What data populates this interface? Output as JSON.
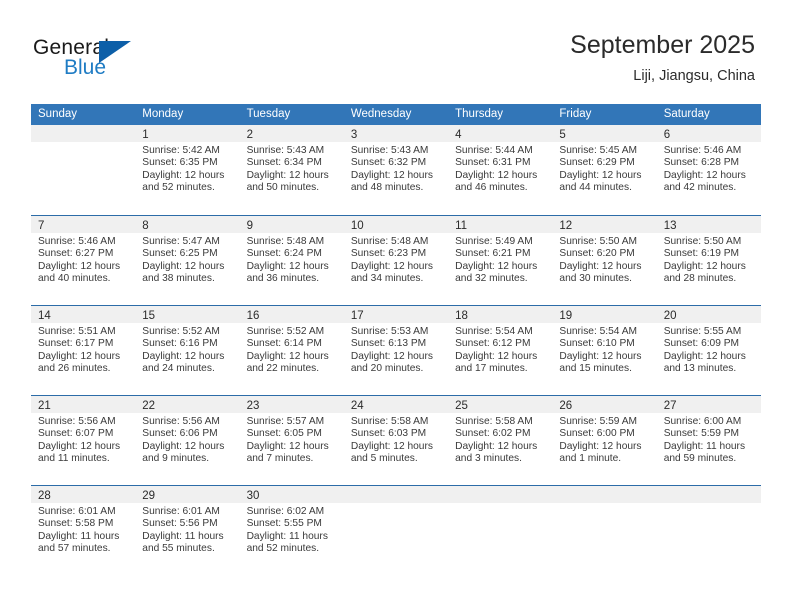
{
  "brand": {
    "name_part1": "General",
    "name_part2": "Blue",
    "accent_color": "#0d5fa8",
    "blue_text_color": "#1f7cc4"
  },
  "header": {
    "title": "September 2025",
    "subtitle": "Liji, Jiangsu, China"
  },
  "calendar": {
    "header_bg": "#3276b8",
    "row_divider": "#2c6ca8",
    "day_band_bg": "#f0f0f0",
    "weekdays": [
      "Sunday",
      "Monday",
      "Tuesday",
      "Wednesday",
      "Thursday",
      "Friday",
      "Saturday"
    ],
    "weeks": [
      [
        {
          "day": "",
          "empty": true
        },
        {
          "day": "1",
          "sunrise": "Sunrise: 5:42 AM",
          "sunset": "Sunset: 6:35 PM",
          "daylight_1": "Daylight: 12 hours",
          "daylight_2": "and 52 minutes."
        },
        {
          "day": "2",
          "sunrise": "Sunrise: 5:43 AM",
          "sunset": "Sunset: 6:34 PM",
          "daylight_1": "Daylight: 12 hours",
          "daylight_2": "and 50 minutes."
        },
        {
          "day": "3",
          "sunrise": "Sunrise: 5:43 AM",
          "sunset": "Sunset: 6:32 PM",
          "daylight_1": "Daylight: 12 hours",
          "daylight_2": "and 48 minutes."
        },
        {
          "day": "4",
          "sunrise": "Sunrise: 5:44 AM",
          "sunset": "Sunset: 6:31 PM",
          "daylight_1": "Daylight: 12 hours",
          "daylight_2": "and 46 minutes."
        },
        {
          "day": "5",
          "sunrise": "Sunrise: 5:45 AM",
          "sunset": "Sunset: 6:29 PM",
          "daylight_1": "Daylight: 12 hours",
          "daylight_2": "and 44 minutes."
        },
        {
          "day": "6",
          "sunrise": "Sunrise: 5:46 AM",
          "sunset": "Sunset: 6:28 PM",
          "daylight_1": "Daylight: 12 hours",
          "daylight_2": "and 42 minutes."
        }
      ],
      [
        {
          "day": "7",
          "sunrise": "Sunrise: 5:46 AM",
          "sunset": "Sunset: 6:27 PM",
          "daylight_1": "Daylight: 12 hours",
          "daylight_2": "and 40 minutes."
        },
        {
          "day": "8",
          "sunrise": "Sunrise: 5:47 AM",
          "sunset": "Sunset: 6:25 PM",
          "daylight_1": "Daylight: 12 hours",
          "daylight_2": "and 38 minutes."
        },
        {
          "day": "9",
          "sunrise": "Sunrise: 5:48 AM",
          "sunset": "Sunset: 6:24 PM",
          "daylight_1": "Daylight: 12 hours",
          "daylight_2": "and 36 minutes."
        },
        {
          "day": "10",
          "sunrise": "Sunrise: 5:48 AM",
          "sunset": "Sunset: 6:23 PM",
          "daylight_1": "Daylight: 12 hours",
          "daylight_2": "and 34 minutes."
        },
        {
          "day": "11",
          "sunrise": "Sunrise: 5:49 AM",
          "sunset": "Sunset: 6:21 PM",
          "daylight_1": "Daylight: 12 hours",
          "daylight_2": "and 32 minutes."
        },
        {
          "day": "12",
          "sunrise": "Sunrise: 5:50 AM",
          "sunset": "Sunset: 6:20 PM",
          "daylight_1": "Daylight: 12 hours",
          "daylight_2": "and 30 minutes."
        },
        {
          "day": "13",
          "sunrise": "Sunrise: 5:50 AM",
          "sunset": "Sunset: 6:19 PM",
          "daylight_1": "Daylight: 12 hours",
          "daylight_2": "and 28 minutes."
        }
      ],
      [
        {
          "day": "14",
          "sunrise": "Sunrise: 5:51 AM",
          "sunset": "Sunset: 6:17 PM",
          "daylight_1": "Daylight: 12 hours",
          "daylight_2": "and 26 minutes."
        },
        {
          "day": "15",
          "sunrise": "Sunrise: 5:52 AM",
          "sunset": "Sunset: 6:16 PM",
          "daylight_1": "Daylight: 12 hours",
          "daylight_2": "and 24 minutes."
        },
        {
          "day": "16",
          "sunrise": "Sunrise: 5:52 AM",
          "sunset": "Sunset: 6:14 PM",
          "daylight_1": "Daylight: 12 hours",
          "daylight_2": "and 22 minutes."
        },
        {
          "day": "17",
          "sunrise": "Sunrise: 5:53 AM",
          "sunset": "Sunset: 6:13 PM",
          "daylight_1": "Daylight: 12 hours",
          "daylight_2": "and 20 minutes."
        },
        {
          "day": "18",
          "sunrise": "Sunrise: 5:54 AM",
          "sunset": "Sunset: 6:12 PM",
          "daylight_1": "Daylight: 12 hours",
          "daylight_2": "and 17 minutes."
        },
        {
          "day": "19",
          "sunrise": "Sunrise: 5:54 AM",
          "sunset": "Sunset: 6:10 PM",
          "daylight_1": "Daylight: 12 hours",
          "daylight_2": "and 15 minutes."
        },
        {
          "day": "20",
          "sunrise": "Sunrise: 5:55 AM",
          "sunset": "Sunset: 6:09 PM",
          "daylight_1": "Daylight: 12 hours",
          "daylight_2": "and 13 minutes."
        }
      ],
      [
        {
          "day": "21",
          "sunrise": "Sunrise: 5:56 AM",
          "sunset": "Sunset: 6:07 PM",
          "daylight_1": "Daylight: 12 hours",
          "daylight_2": "and 11 minutes."
        },
        {
          "day": "22",
          "sunrise": "Sunrise: 5:56 AM",
          "sunset": "Sunset: 6:06 PM",
          "daylight_1": "Daylight: 12 hours",
          "daylight_2": "and 9 minutes."
        },
        {
          "day": "23",
          "sunrise": "Sunrise: 5:57 AM",
          "sunset": "Sunset: 6:05 PM",
          "daylight_1": "Daylight: 12 hours",
          "daylight_2": "and 7 minutes."
        },
        {
          "day": "24",
          "sunrise": "Sunrise: 5:58 AM",
          "sunset": "Sunset: 6:03 PM",
          "daylight_1": "Daylight: 12 hours",
          "daylight_2": "and 5 minutes."
        },
        {
          "day": "25",
          "sunrise": "Sunrise: 5:58 AM",
          "sunset": "Sunset: 6:02 PM",
          "daylight_1": "Daylight: 12 hours",
          "daylight_2": "and 3 minutes."
        },
        {
          "day": "26",
          "sunrise": "Sunrise: 5:59 AM",
          "sunset": "Sunset: 6:00 PM",
          "daylight_1": "Daylight: 12 hours",
          "daylight_2": "and 1 minute."
        },
        {
          "day": "27",
          "sunrise": "Sunrise: 6:00 AM",
          "sunset": "Sunset: 5:59 PM",
          "daylight_1": "Daylight: 11 hours",
          "daylight_2": "and 59 minutes."
        }
      ],
      [
        {
          "day": "28",
          "sunrise": "Sunrise: 6:01 AM",
          "sunset": "Sunset: 5:58 PM",
          "daylight_1": "Daylight: 11 hours",
          "daylight_2": "and 57 minutes."
        },
        {
          "day": "29",
          "sunrise": "Sunrise: 6:01 AM",
          "sunset": "Sunset: 5:56 PM",
          "daylight_1": "Daylight: 11 hours",
          "daylight_2": "and 55 minutes."
        },
        {
          "day": "30",
          "sunrise": "Sunrise: 6:02 AM",
          "sunset": "Sunset: 5:55 PM",
          "daylight_1": "Daylight: 11 hours",
          "daylight_2": "and 52 minutes."
        },
        {
          "day": "",
          "empty": true
        },
        {
          "day": "",
          "empty": true
        },
        {
          "day": "",
          "empty": true
        },
        {
          "day": "",
          "empty": true
        }
      ]
    ]
  }
}
